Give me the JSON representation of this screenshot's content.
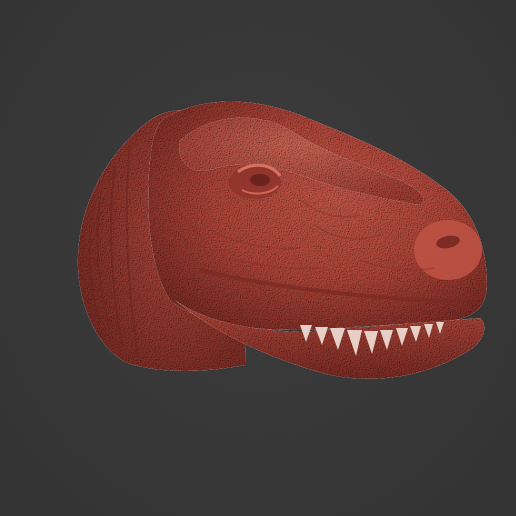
{
  "viewport": {
    "background_color": "#373737"
  },
  "model": {
    "subject": "t-rex-head-sculpt",
    "material_color": "#b5473a",
    "shadow_color": "#6e2620",
    "highlight_color": "#cf6656"
  }
}
